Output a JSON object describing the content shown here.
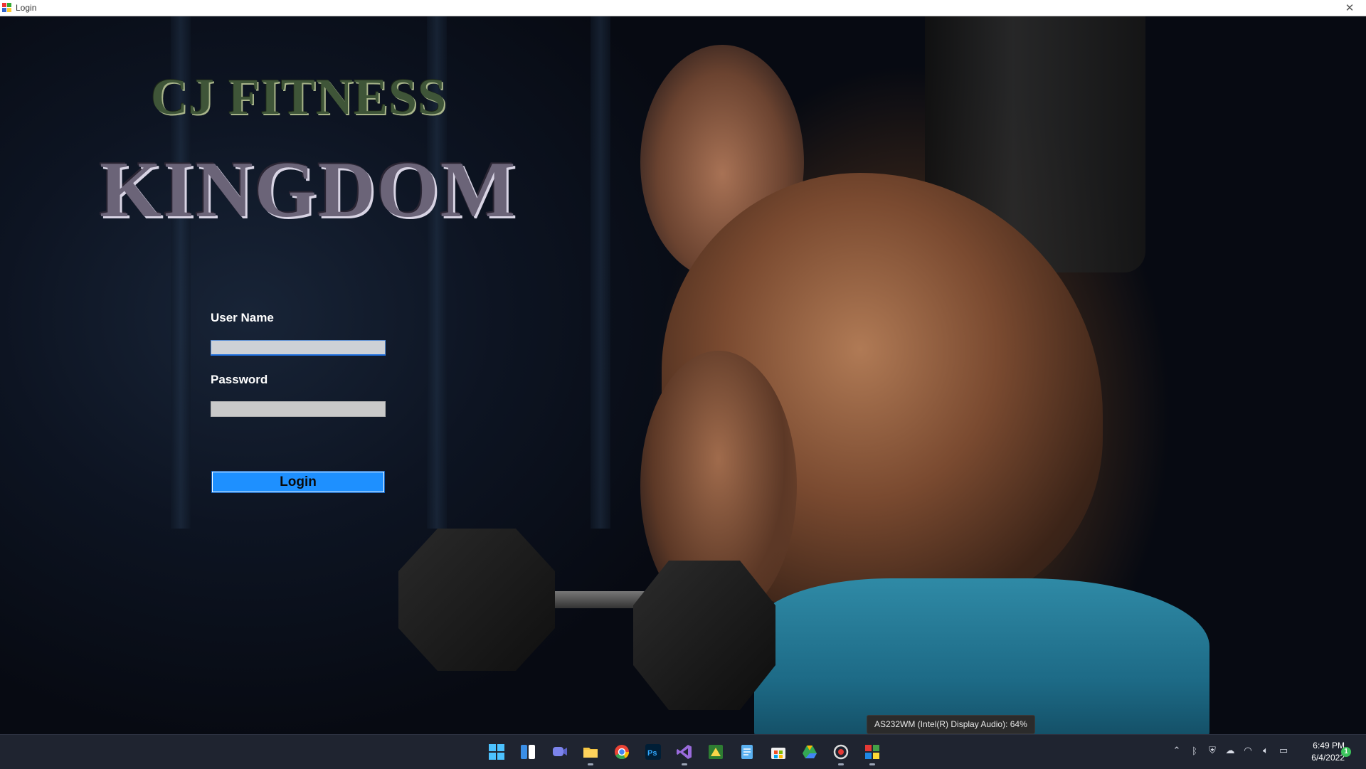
{
  "window": {
    "title": "Login",
    "close_glyph": "✕"
  },
  "logo": {
    "line1": "CJ FITNESS",
    "line2": "KINGDOM"
  },
  "form": {
    "username_label": "User Name",
    "username_value": "",
    "password_label": "Password",
    "password_value": "",
    "login_label": "Login"
  },
  "tooltip": {
    "text": "AS232WM (Intel(R) Display Audio): 64%"
  },
  "taskbar": {
    "apps": [
      {
        "icon": "windows-start-icon"
      },
      {
        "icon": "widgets-icon"
      },
      {
        "icon": "teams-chat-icon"
      },
      {
        "icon": "file-explorer-icon"
      },
      {
        "icon": "chrome-icon"
      },
      {
        "icon": "photoshop-icon",
        "text": "Ps"
      },
      {
        "icon": "visual-studio-icon"
      },
      {
        "icon": "sticky-app-icon"
      },
      {
        "icon": "notepad-icon"
      },
      {
        "icon": "store-icon"
      },
      {
        "icon": "google-drive-icon"
      },
      {
        "icon": "recorder-icon"
      },
      {
        "icon": "login-app-icon"
      }
    ],
    "clock_time": "6:49 PM",
    "clock_date": "6/4/2022",
    "notification_count": "1"
  },
  "colors": {
    "login_button": "#1e90ff",
    "taskbar_bg": "#1f2430",
    "shorts": "#2f8aa6"
  }
}
